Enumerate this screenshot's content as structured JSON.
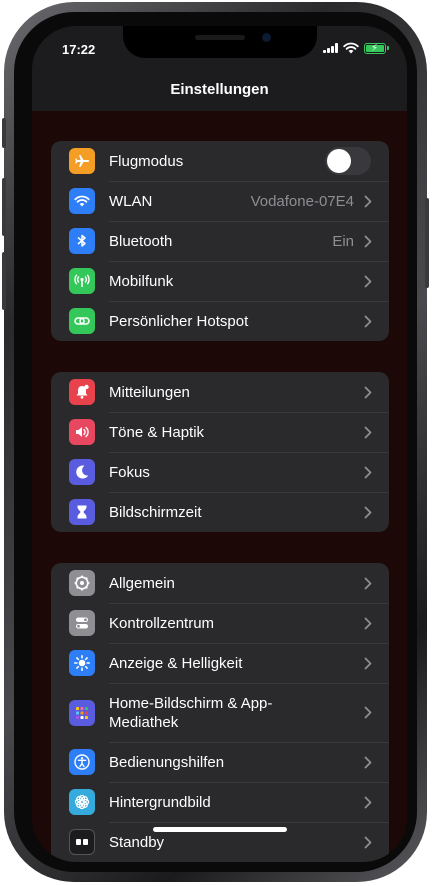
{
  "status": {
    "time": "17:22"
  },
  "nav": {
    "title": "Einstellungen"
  },
  "group1": [
    {
      "icon": "airplane-icon",
      "label": "Flugmodus",
      "value": "",
      "control": "toggle",
      "toggle_on": false,
      "color": "#f59e25"
    },
    {
      "icon": "wifi-icon",
      "label": "WLAN",
      "value": "Vodafone-07E4",
      "control": "chevron",
      "color": "#2d7ef7"
    },
    {
      "icon": "bluetooth-icon",
      "label": "Bluetooth",
      "value": "Ein",
      "control": "chevron",
      "color": "#2d7ef7"
    },
    {
      "icon": "antenna-icon",
      "label": "Mobilfunk",
      "value": "",
      "control": "chevron",
      "color": "#34c759"
    },
    {
      "icon": "hotspot-link-icon",
      "label": "Persönlicher Hotspot",
      "value": "",
      "control": "chevron",
      "color": "#34c759"
    }
  ],
  "group2": [
    {
      "icon": "bell-icon",
      "label": "Mitteilungen",
      "control": "chevron",
      "color": "#e8434c"
    },
    {
      "icon": "speaker-icon",
      "label": "Töne & Haptik",
      "control": "chevron",
      "color": "#e7475f"
    },
    {
      "icon": "moon-icon",
      "label": "Fokus",
      "control": "chevron",
      "color": "#5a5ce0"
    },
    {
      "icon": "hourglass-icon",
      "label": "Bildschirmzeit",
      "control": "chevron",
      "color": "#5a5ce0"
    }
  ],
  "group3": [
    {
      "icon": "gear-icon",
      "label": "Allgemein",
      "control": "chevron",
      "color": "#8e8e93"
    },
    {
      "icon": "switches-icon",
      "label": "Kontrollzentrum",
      "control": "chevron",
      "color": "#8e8e93"
    },
    {
      "icon": "sun-icon",
      "label": "Anzeige & Helligkeit",
      "control": "chevron",
      "color": "#2d7ef7"
    },
    {
      "icon": "app-grid-icon",
      "label": "Home-Bildschirm & App-Mediathek",
      "control": "chevron",
      "color": "#5a5ce0"
    },
    {
      "icon": "accessibility-icon",
      "label": "Bedienungshilfen",
      "control": "chevron",
      "color": "#2d7ef7"
    },
    {
      "icon": "flower-icon",
      "label": "Hintergrundbild",
      "control": "chevron",
      "color": "#35aadc"
    },
    {
      "icon": "standby-icon",
      "label": "Standby",
      "control": "chevron",
      "color": "#1c1c1e"
    }
  ],
  "colors": {
    "background": "#1d0808",
    "cell": "#2a2a2c",
    "secondary_text": "#8e8e93",
    "battery": "#34c759"
  }
}
